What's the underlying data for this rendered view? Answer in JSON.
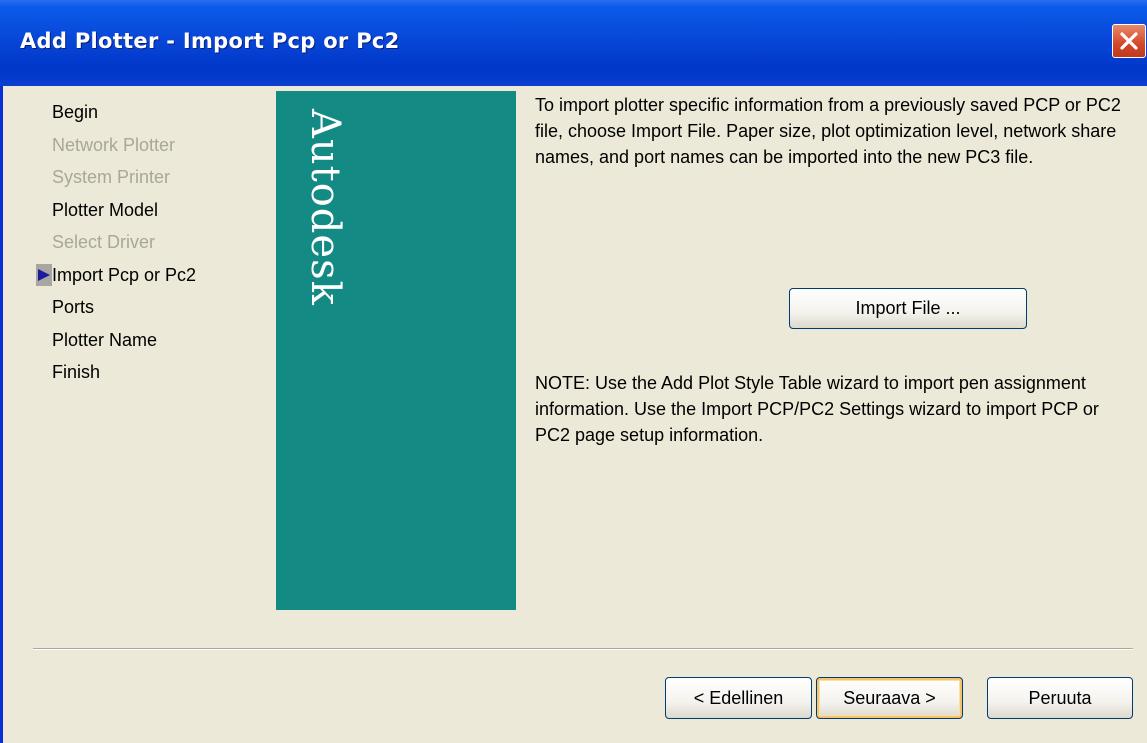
{
  "window": {
    "title": "Add Plotter - Import Pcp or Pc2"
  },
  "steps": [
    {
      "label": "Begin",
      "state": "enabled"
    },
    {
      "label": "Network Plotter",
      "state": "disabled"
    },
    {
      "label": "System Printer",
      "state": "disabled"
    },
    {
      "label": "Plotter Model",
      "state": "enabled"
    },
    {
      "label": "Select Driver",
      "state": "disabled"
    },
    {
      "label": "Import Pcp or Pc2",
      "state": "current"
    },
    {
      "label": "Ports",
      "state": "enabled"
    },
    {
      "label": "Plotter Name",
      "state": "enabled"
    },
    {
      "label": "Finish",
      "state": "enabled"
    }
  ],
  "banner": {
    "logo_text": "Autodesk",
    "color": "#138a84"
  },
  "content": {
    "intro": "To import plotter specific information from a previously saved PCP or PC2 file, choose Import File. Paper size, plot optimization level, network share names, and port names can be imported into the new PC3 file.",
    "import_button": "Import File ...",
    "note": "NOTE: Use the Add Plot Style Table wizard to import pen assignment information. Use the Import PCP/PC2 Settings wizard to import PCP or PC2 page setup information."
  },
  "footer": {
    "back_button": "< Edellinen",
    "next_button": "Seuraava >",
    "cancel_button": "Peruuta"
  },
  "colors": {
    "titlebar": "#0847d8",
    "dialog_bg": "#ece9d8",
    "close_button": "#d2472a",
    "disabled_text": "#a8a799",
    "current_arrow": "#1b1b9c"
  },
  "icons": {
    "close": "close-icon",
    "current_step": "play-arrow-icon"
  }
}
